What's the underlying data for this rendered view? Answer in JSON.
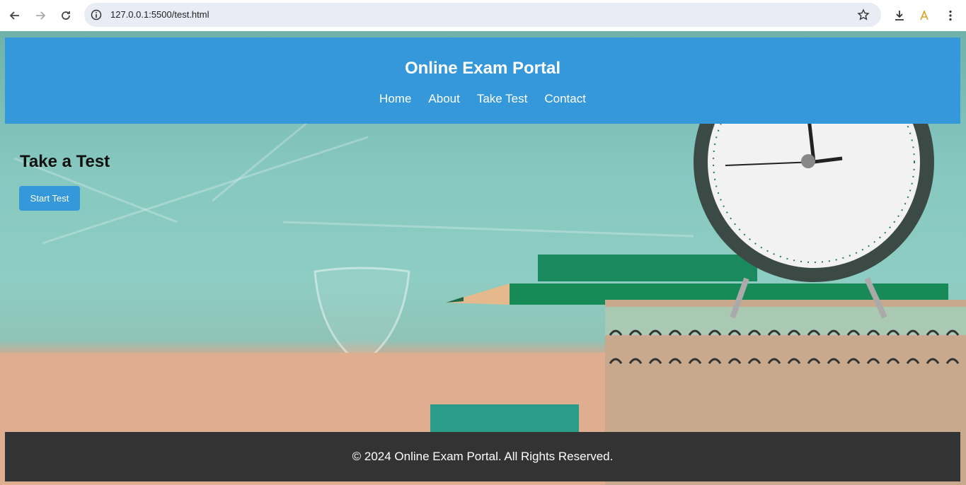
{
  "browser": {
    "url": "127.0.0.1:5500/test.html",
    "icons": [
      "back-icon",
      "forward-icon",
      "reload-icon",
      "site-info-icon",
      "bookmark-star-icon",
      "download-icon",
      "extension-icon",
      "menu-icon"
    ]
  },
  "header": {
    "title": "Online Exam Portal",
    "nav": [
      "Home",
      "About",
      "Take Test",
      "Contact"
    ]
  },
  "main": {
    "heading": "Take a Test",
    "start_button": "Start Test"
  },
  "footer": {
    "text": "© 2024 Online Exam Portal. All Rights Reserved."
  },
  "colors": {
    "header_bg": "#3498db",
    "button_bg": "#3498db",
    "footer_bg": "#333333"
  }
}
